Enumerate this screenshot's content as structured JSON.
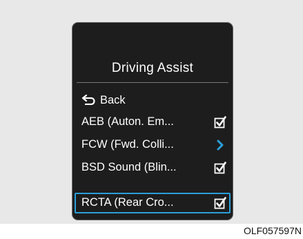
{
  "screen": {
    "title": "Driving Assist",
    "back_label": "Back",
    "items": [
      {
        "label": "AEB (Auton. Em...",
        "control": "checkbox",
        "checked": true
      },
      {
        "label": "FCW (Fwd. Colli...",
        "control": "chevron-right"
      },
      {
        "label": "BSD Sound (Blin...",
        "control": "checkbox",
        "checked": true
      },
      {
        "label": "RCTA (Rear Cro...",
        "control": "checkbox",
        "checked": true,
        "selected": true
      }
    ]
  },
  "caption": "OLF057597N",
  "colors": {
    "screen_bg": "#1d1d1d",
    "accent": "#2a9fd9",
    "text": "#ffffff",
    "frame_bg": "#e8e8e8"
  }
}
